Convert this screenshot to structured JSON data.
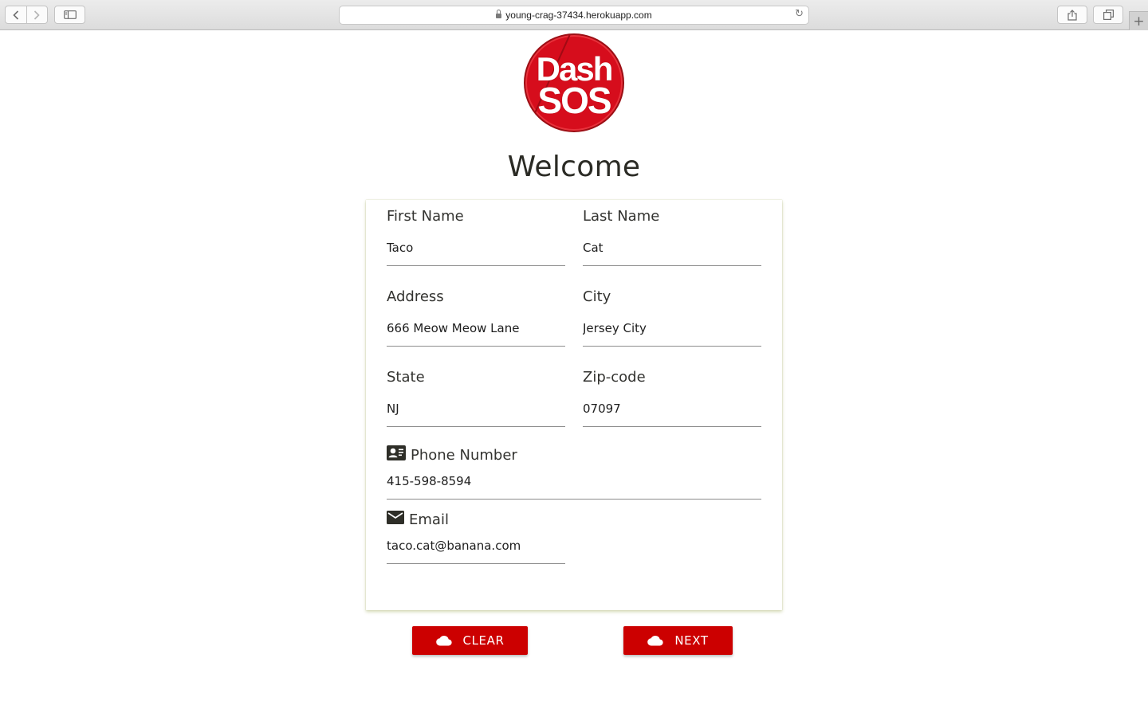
{
  "browser": {
    "url": "young-crag-37434.herokuapp.com",
    "back_icon": "‹",
    "forward_icon": "›",
    "new_tab_icon": "+"
  },
  "logo": {
    "line1": "Dash",
    "line2": "SOS",
    "color": "#d60d1c"
  },
  "page": {
    "title": "Welcome"
  },
  "form": {
    "first_name": {
      "label": "First Name",
      "value": "Taco"
    },
    "last_name": {
      "label": "Last Name",
      "value": "Cat"
    },
    "address": {
      "label": "Address",
      "value": "666 Meow Meow Lane"
    },
    "city": {
      "label": "City",
      "value": "Jersey City"
    },
    "state": {
      "label": "State",
      "value": "NJ"
    },
    "zip": {
      "label": "Zip-code",
      "value": "07097"
    },
    "phone": {
      "label": "Phone Number",
      "value": "415-598-8594",
      "icon": "contact-card-icon"
    },
    "email": {
      "label": "Email",
      "value": "taco.cat@banana.com",
      "icon": "envelope-icon"
    }
  },
  "buttons": {
    "clear": {
      "label": "CLEAR",
      "icon": "cloud-icon"
    },
    "next": {
      "label": "NEXT",
      "icon": "cloud-icon"
    },
    "color": "#cc0000"
  }
}
